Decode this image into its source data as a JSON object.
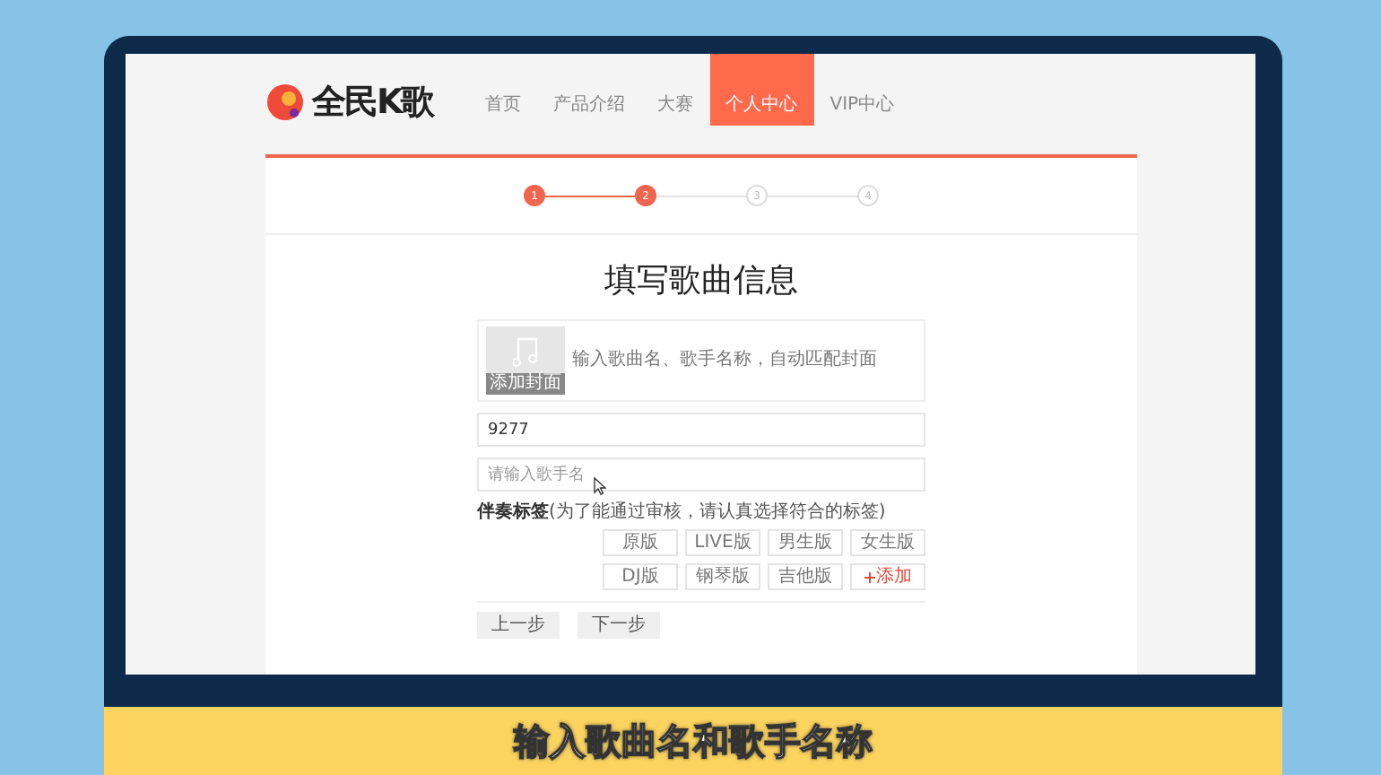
{
  "nav": {
    "logo": "全民K歌",
    "items": [
      {
        "label": "首页",
        "selected": false
      },
      {
        "label": "产品介绍",
        "selected": false
      },
      {
        "label": "大赛",
        "selected": false
      },
      {
        "label": "个人中心",
        "selected": true
      },
      {
        "label": "VIP中心",
        "selected": false
      }
    ]
  },
  "steps": [
    {
      "label": "1",
      "done": true
    },
    {
      "label": "2",
      "done": true
    },
    {
      "label": "3",
      "done": false
    },
    {
      "label": "4",
      "done": false
    }
  ],
  "form": {
    "title": "填写歌曲信息",
    "cover": {
      "button": "添加封面",
      "hint": "输入歌曲名、歌手名称，自动匹配封面"
    },
    "song_name": {
      "value": "9277"
    },
    "singer": {
      "placeholder": "请输入歌手名"
    },
    "tag_label": {
      "title": "伴奏标签",
      "note": "(为了能通过审核，请认真选择符合的标签)"
    },
    "tags": [
      {
        "label": "原版",
        "kind": "tag"
      },
      {
        "label": "LIVE版",
        "kind": "tag"
      },
      {
        "label": "男生版",
        "kind": "tag"
      },
      {
        "label": "女生版",
        "kind": "tag"
      },
      {
        "label": "DJ版",
        "kind": "tag"
      },
      {
        "label": "钢琴版",
        "kind": "tag"
      },
      {
        "label": "吉他版",
        "kind": "tag"
      },
      {
        "label": "添加",
        "kind": "add"
      }
    ],
    "buttons": [
      "上一步",
      "下一步"
    ]
  },
  "caption": "输入歌曲名和歌手名称"
}
